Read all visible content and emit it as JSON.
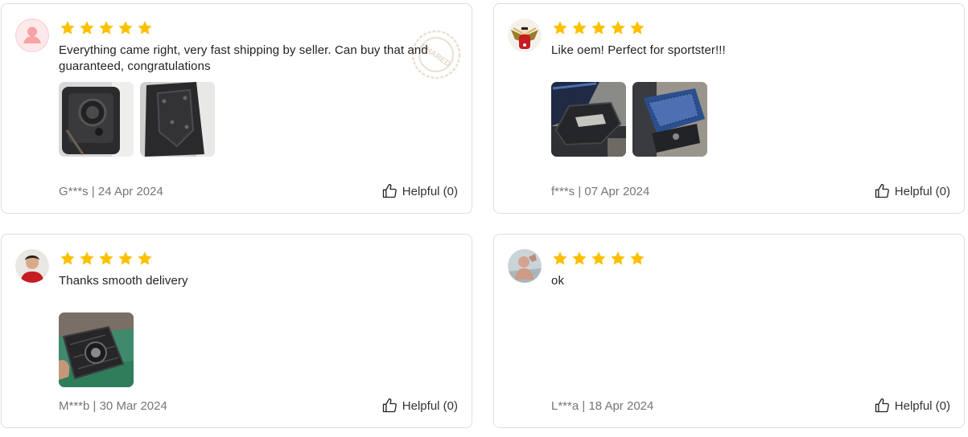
{
  "reviews": [
    {
      "rating": 5,
      "text": "Everything came right, very fast shipping by seller. Can buy that and guaranteed, congratulations",
      "author": "G***s",
      "date": "24 Apr 2024",
      "helpful_label": "Helpful (0)",
      "stamp_text": "SHARED",
      "avatar": "default-person-icon",
      "photos": 2
    },
    {
      "rating": 5,
      "text": "Like oem! Perfect for sportster!!!",
      "author": "f***s",
      "date": "07 Apr 2024",
      "helpful_label": "Helpful (0)",
      "avatar": "user-photo",
      "photos": 2
    },
    {
      "rating": 5,
      "text": "Thanks smooth delivery",
      "author": "M***b",
      "date": "30 Mar 2024",
      "helpful_label": "Helpful (0)",
      "avatar": "user-photo",
      "photos": 1
    },
    {
      "rating": 5,
      "text": "ok",
      "author": "L***a",
      "date": "18 Apr 2024",
      "helpful_label": "Helpful (0)",
      "avatar": "user-photo",
      "photos": 0
    }
  ],
  "separator": " | ",
  "colors": {
    "star": "#fcc000",
    "border": "#dedede",
    "meta_text": "#757575"
  }
}
